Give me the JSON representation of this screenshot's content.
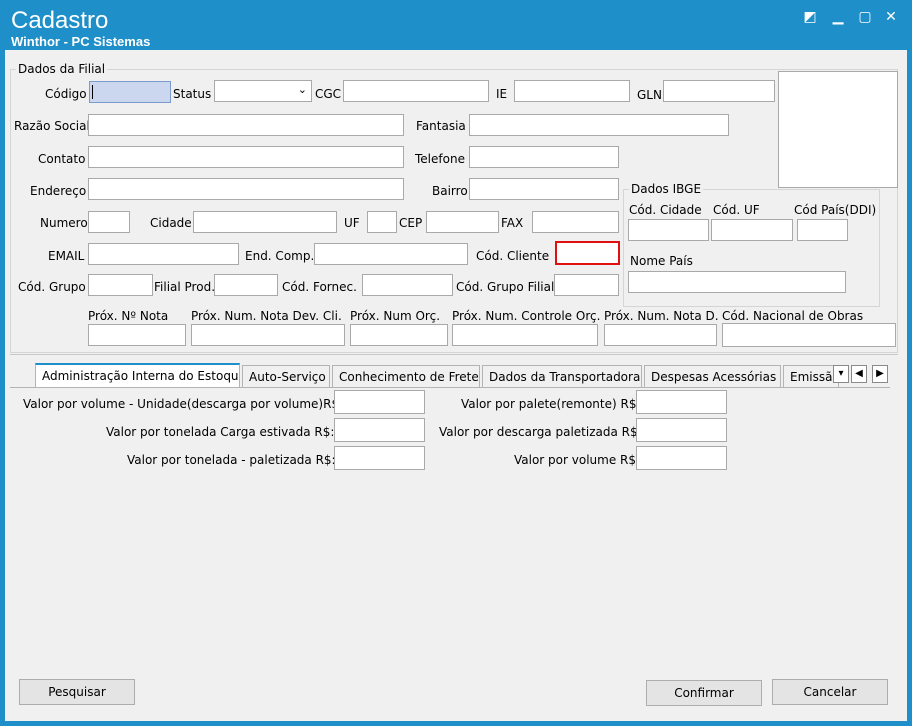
{
  "window": {
    "title": "Cadastro",
    "subtitle": "Winthor - PC Sistemas",
    "controls": {
      "restore": "◩",
      "minimize": "▁",
      "maximize": "▢",
      "close": "✕"
    }
  },
  "filial": {
    "group_title": "Dados da Filial",
    "labels": {
      "codigo": "Código",
      "status": "Status",
      "cgc": "CGC",
      "ie": "IE",
      "gln": "GLN",
      "razao_social": "Razão Social",
      "fantasia": "Fantasia",
      "contato": "Contato",
      "telefone": "Telefone",
      "endereco": "Endereço",
      "bairro": "Bairro",
      "numero": "Numero",
      "cidade": "Cidade",
      "uf": "UF",
      "cep": "CEP",
      "fax": "FAX",
      "email": "EMAIL",
      "end_comp": "End. Comp.",
      "cod_cliente": "Cód. Cliente",
      "cod_grupo": "Cód. Grupo",
      "filial_prod": "Filial Prod.",
      "cod_fornec": "Cód. Fornec.",
      "cod_grupo_filial": "Cód. Grupo Filial",
      "prox_nota": "Próx. Nº Nota",
      "prox_nota_dev": "Próx. Num. Nota Dev. Cli.",
      "prox_orc": "Próx. Num Orç.",
      "prox_controle_orc": "Próx. Num. Controle Orç.",
      "prox_nota_d": "Próx. Num. Nota D.",
      "cod_obras": "Cód. Nacional de Obras"
    }
  },
  "ibge": {
    "group_title": "Dados IBGE",
    "labels": {
      "cod_cidade": "Cód. Cidade",
      "cod_uf": "Cód. UF",
      "cod_pais": "Cód País(DDI)",
      "nome_pais": "Nome País"
    }
  },
  "tabs": [
    {
      "label": "Administração Interna do Estoque"
    },
    {
      "label": "Auto-Serviço"
    },
    {
      "label": "Conhecimento de Frete"
    },
    {
      "label": "Dados da Transportadora"
    },
    {
      "label": "Despesas Acessórias"
    },
    {
      "label": "Emissã"
    }
  ],
  "tab_scroll": {
    "dropdown": "▾",
    "left": "◀",
    "right": "▶"
  },
  "estoque": {
    "valor_volume_unidade": "Valor por volume - Unidade(descarga por volume)R$:",
    "valor_tonelada_carga": "Valor por tonelada Carga estivada R$:",
    "valor_tonelada_paletizada": "Valor por tonelada - paletizada R$:",
    "valor_palete": "Valor por palete(remonte) R$:",
    "valor_descarga_paletizada": "Valor por descarga paletizada R$:",
    "valor_volume": "Valor por volume R$:"
  },
  "buttons": {
    "pesquisar": "Pesquisar",
    "confirmar": "Confirmar",
    "cancelar": "Cancelar"
  }
}
